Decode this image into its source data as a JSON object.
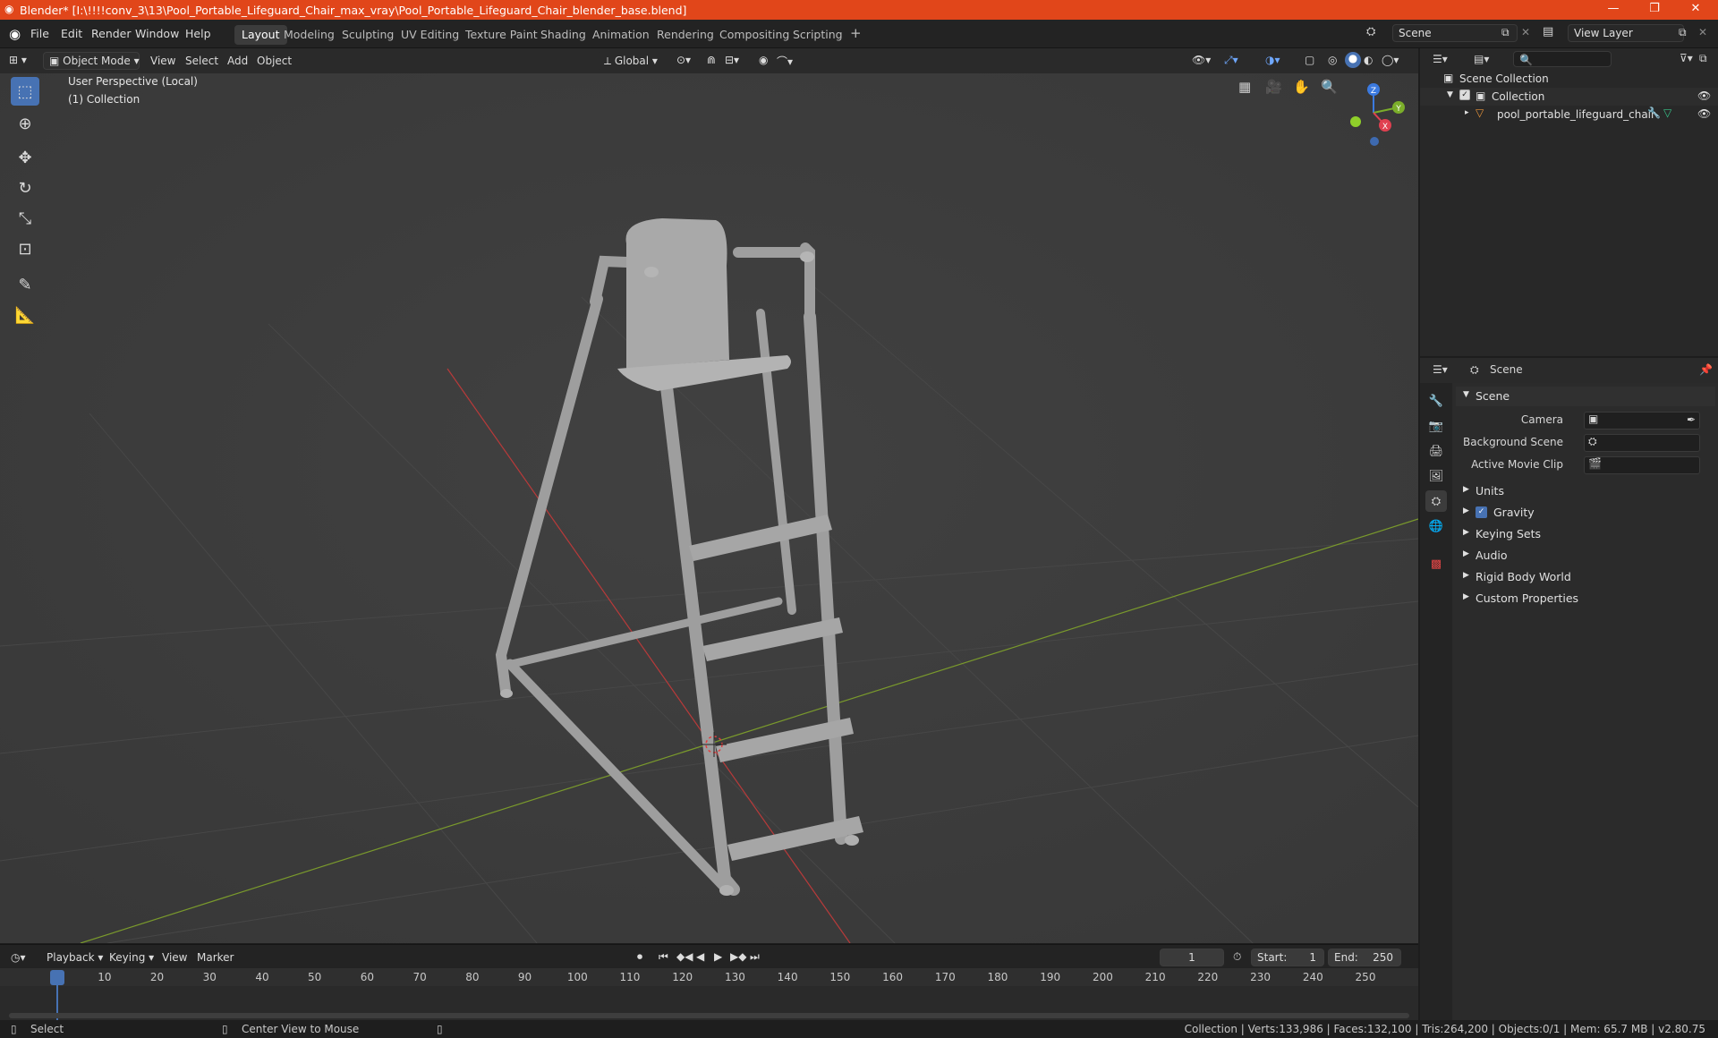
{
  "title_bar": {
    "title": "Blender* [I:\\!!!!conv_3\\13\\Pool_Portable_Lifeguard_Chair_max_vray\\Pool_Portable_Lifeguard_Chair_blender_base.blend]",
    "accent": "#e1461a"
  },
  "main_menu": [
    "File",
    "Edit",
    "Render",
    "Window",
    "Help"
  ],
  "workspaces": [
    "Layout",
    "Modeling",
    "Sculpting",
    "UV Editing",
    "Texture Paint",
    "Shading",
    "Animation",
    "Rendering",
    "Compositing",
    "Scripting"
  ],
  "active_workspace": "Layout",
  "scene_field": "Scene",
  "view_layer_field": "View Layer",
  "viewport_header": {
    "mode": "Object Mode",
    "menus": [
      "View",
      "Select",
      "Add",
      "Object"
    ],
    "orientation": "Global"
  },
  "viewport": {
    "perspective": "User Perspective (Local)",
    "collection": "(1) Collection",
    "gizmo": {
      "z": "Z",
      "y": "Y",
      "x": "X"
    }
  },
  "toolbar_icons": [
    "select-box-icon",
    "cursor-icon",
    "move-icon",
    "rotate-icon",
    "scale-icon",
    "transform-icon",
    "annotate-icon",
    "measure-icon"
  ],
  "outliner": {
    "root": "Scene Collection",
    "collection": "Collection",
    "object": "pool_portable_lifeguard_chair"
  },
  "properties": {
    "breadcrumb": "Scene",
    "section": "Scene",
    "fields": [
      {
        "label": "Camera"
      },
      {
        "label": "Background Scene"
      },
      {
        "label": "Active Movie Clip"
      }
    ],
    "panels": [
      "Units",
      "Gravity",
      "Keying Sets",
      "Audio",
      "Rigid Body World",
      "Custom Properties"
    ],
    "gravity_checked": true
  },
  "timeline": {
    "menus": [
      "Playback",
      "Keying",
      "View",
      "Marker"
    ],
    "current_frame": "1",
    "start_label": "Start:",
    "start_value": "1",
    "end_label": "End:",
    "end_value": "250",
    "ticks": [
      "1",
      "10",
      "20",
      "30",
      "40",
      "50",
      "60",
      "70",
      "80",
      "90",
      "100",
      "110",
      "120",
      "130",
      "140",
      "150",
      "160",
      "170",
      "180",
      "190",
      "200",
      "210",
      "220",
      "230",
      "240",
      "250"
    ]
  },
  "status_bar": {
    "left": "Select",
    "middle": "Center View to Mouse",
    "right": "Collection | Verts:133,986 | Faces:132,100 | Tris:264,200 | Objects:0/1 | Mem: 65.7 MB | v2.80.75"
  }
}
